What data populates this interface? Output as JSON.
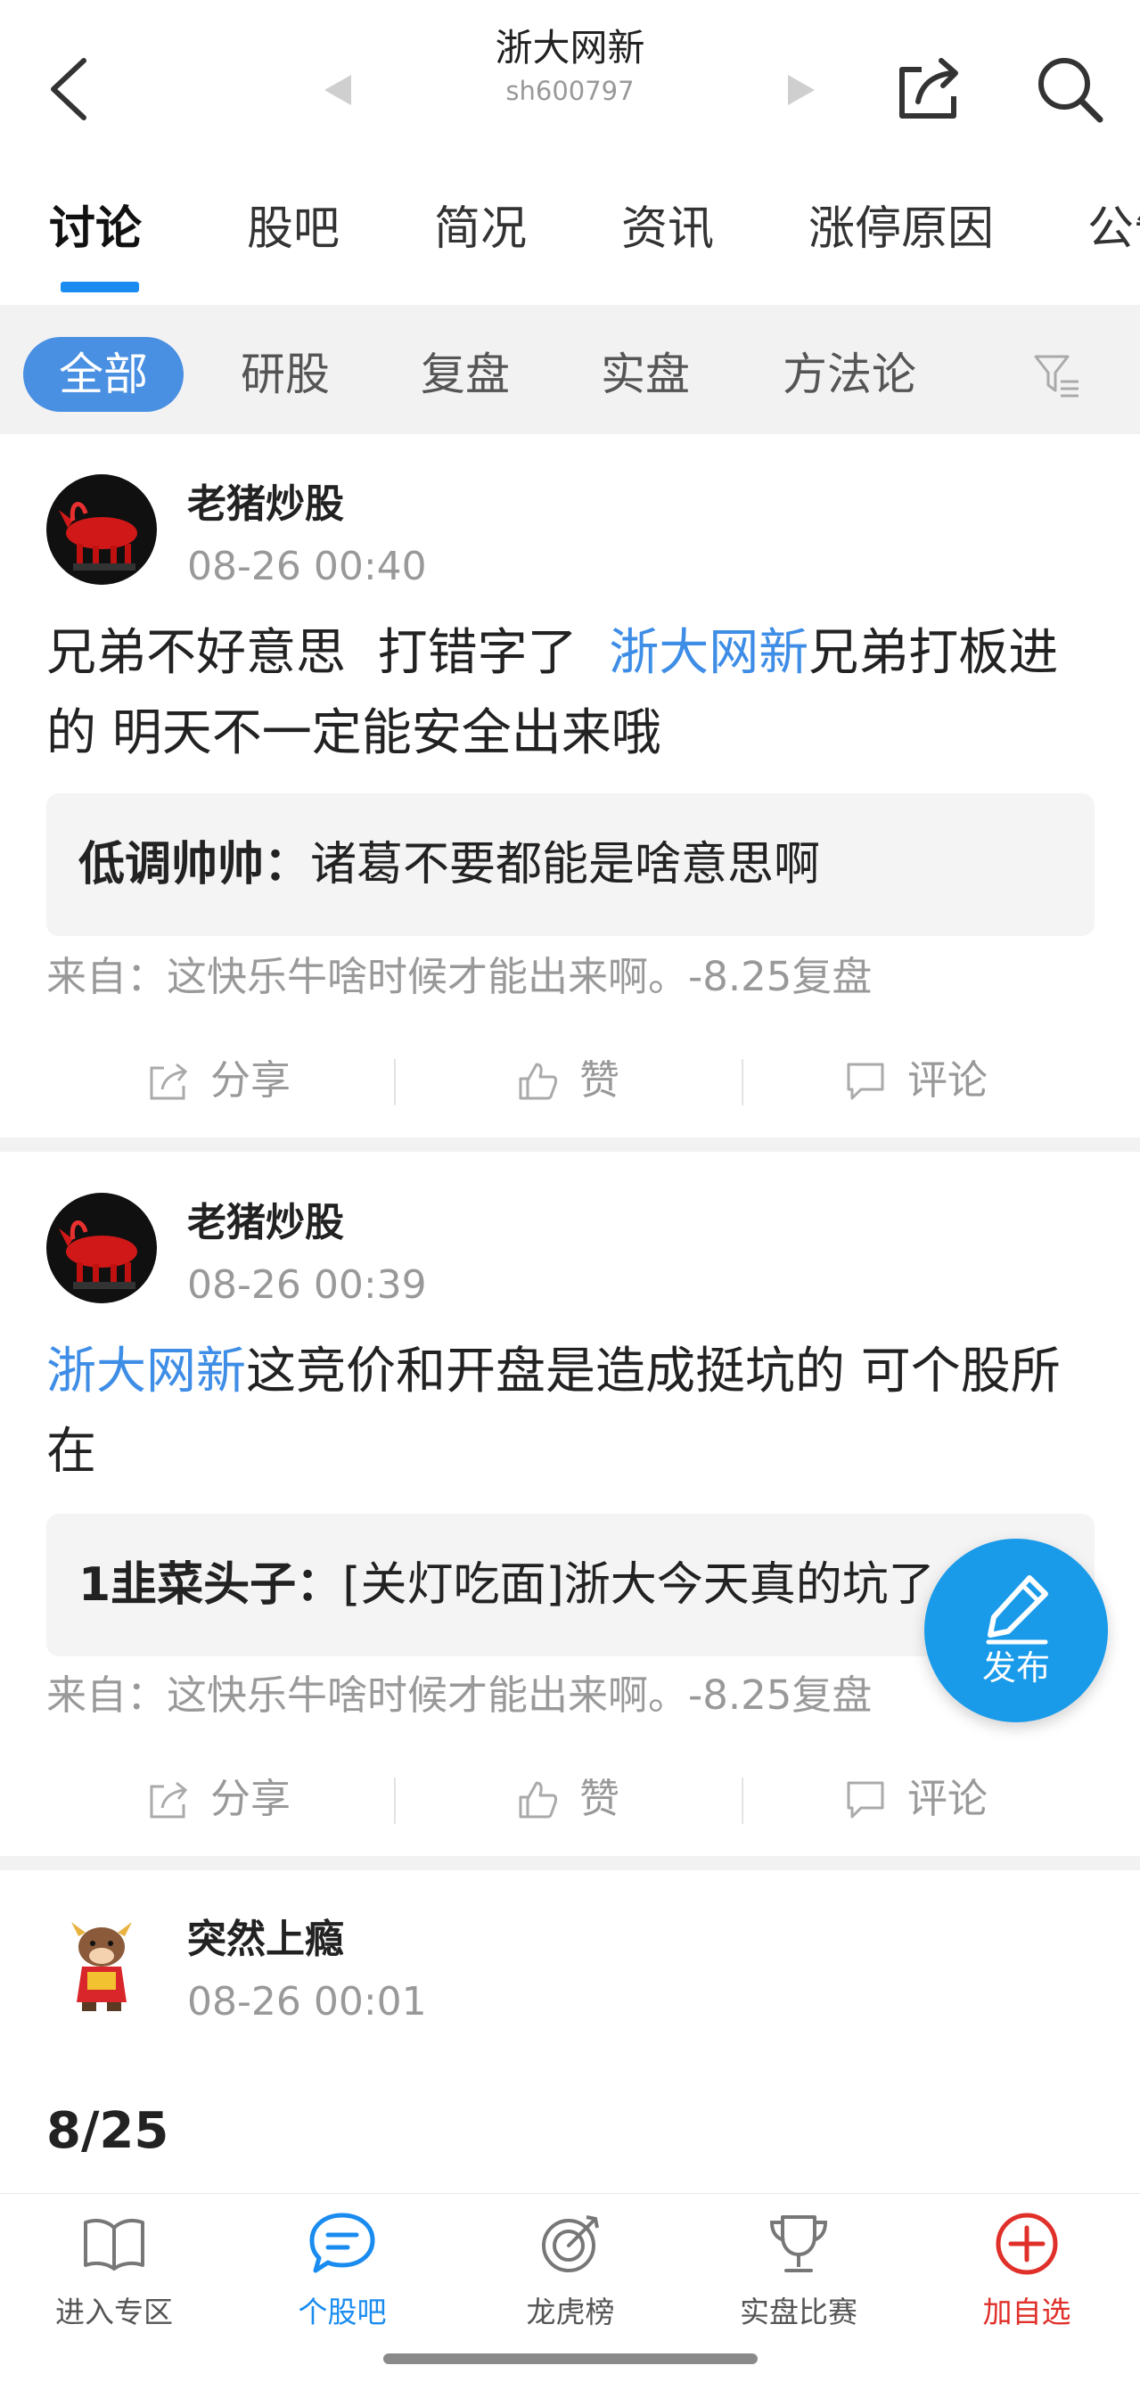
{
  "header": {
    "title": "浙大网新",
    "code": "sh600797",
    "icons": [
      "back-chevron",
      "prev-stock-arrow",
      "next-stock-arrow",
      "share-icon",
      "search-icon"
    ]
  },
  "tabs": [
    {
      "label": "讨论",
      "active": true
    },
    {
      "label": "股吧"
    },
    {
      "label": "简况"
    },
    {
      "label": "资讯"
    },
    {
      "label": "涨停原因"
    },
    {
      "label": "公告"
    }
  ],
  "filters": [
    {
      "label": "全部",
      "active": true
    },
    {
      "label": "研股"
    },
    {
      "label": "复盘"
    },
    {
      "label": "实盘"
    },
    {
      "label": "方法论"
    }
  ],
  "posts": [
    {
      "user": "老猪炒股",
      "time": "08-26 00:40",
      "body_pre": "兄弟不好意思  打错字了  ",
      "stock": "浙大网新",
      "body_post": "兄弟打板进的 明天不一定能安全出来哦",
      "quote_author": "低调帅帅：",
      "quote_text": "诸葛不要都能是啥意思啊",
      "from": "来自：这快乐牛啥时候才能出来啊。-8.25复盘"
    },
    {
      "user": "老猪炒股",
      "time": "08-26 00:39",
      "body_pre": "",
      "stock": "浙大网新",
      "body_post": "这竞价和开盘是造成挺坑的 可个股所在",
      "quote_author": "1韭菜头子：",
      "quote_text": "[关灯吃面]浙大今天真的坑了",
      "from": "来自：这快乐牛啥时候才能出来啊。-8.25复盘"
    },
    {
      "user": "突然上瘾",
      "time": "08-26 00:01",
      "body_text": "8/25"
    }
  ],
  "actions": {
    "share": "分享",
    "like": "赞",
    "comment": "评论"
  },
  "fab_label": "发布",
  "bottom_nav": [
    {
      "label": "进入专区",
      "icon": "book-icon"
    },
    {
      "label": "个股吧",
      "icon": "chat-icon",
      "active": true
    },
    {
      "label": "龙虎榜",
      "icon": "target-icon"
    },
    {
      "label": "实盘比赛",
      "icon": "trophy-icon"
    },
    {
      "label": "加自选",
      "icon": "add-circle-icon",
      "color": "#e0302a"
    }
  ],
  "colors": {
    "accent": "#1a8cf0",
    "link": "#3e8de6",
    "red": "#e0302a"
  }
}
